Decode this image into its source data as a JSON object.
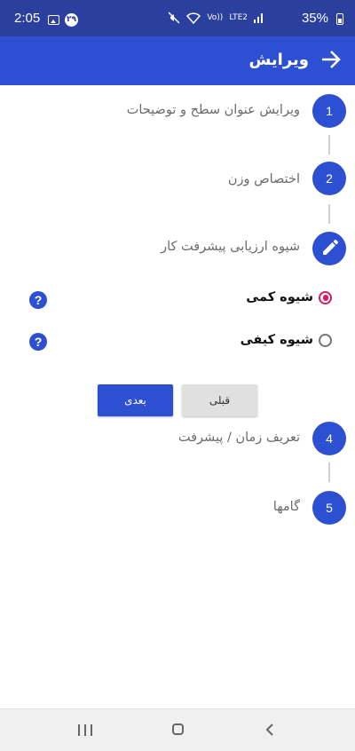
{
  "status_bar": {
    "time": "2:05",
    "notification_badge": "۲۹",
    "battery_percent": "35%",
    "network_label": "LTE2",
    "volte_label": "Vo))"
  },
  "app_bar": {
    "title": "ویرایش"
  },
  "steps": [
    {
      "number": "1",
      "label": "ویرایش عنوان سطح و توضیحات"
    },
    {
      "number": "2",
      "label": "اختصاص وزن"
    },
    {
      "icon": "pencil-icon",
      "label": "شیوه ارزیابی پیشرفت کار"
    },
    {
      "number": "4",
      "label": "تعریف زمان / پیشرفت"
    },
    {
      "number": "5",
      "label": "گامها"
    }
  ],
  "options": [
    {
      "label": "شیوه کمی",
      "selected": true,
      "help": "?"
    },
    {
      "label": "شیوه کیفی",
      "selected": false,
      "help": "?"
    }
  ],
  "buttons": {
    "next": "بعدی",
    "prev": "قبلی"
  },
  "colors": {
    "status_bar": "#2a3f9e",
    "primary": "#2d4fd1",
    "radio_selected": "#d81b60"
  }
}
